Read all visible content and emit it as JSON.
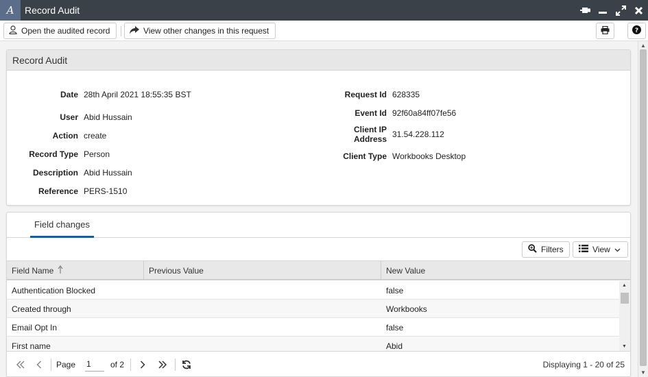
{
  "window": {
    "title": "Record Audit",
    "logo_letter": "A",
    "accent": "#1f5b94"
  },
  "toolbar": {
    "open_record_label": "Open the audited record",
    "view_changes_label": "View other changes in this request"
  },
  "audit": {
    "heading": "Record Audit",
    "left_fields": [
      {
        "label": "Date",
        "value": "28th April 2021 18:55:35 BST"
      },
      {
        "label": "User",
        "value": "Abid Hussain"
      },
      {
        "label": "Action",
        "value": "create"
      },
      {
        "label": "Record Type",
        "value": "Person"
      },
      {
        "label": "Description",
        "value": "Abid Hussain"
      },
      {
        "label": "Reference",
        "value": "PERS-1510"
      }
    ],
    "right_fields": [
      {
        "label": "Request Id",
        "value": "628335"
      },
      {
        "label": "Event Id",
        "value": "92f60a84ff07fe56"
      },
      {
        "label_line1": "Client IP",
        "label_line2": "Address",
        "value": "31.54.228.112"
      },
      {
        "label": "Client Type",
        "value": "Workbooks Desktop"
      }
    ]
  },
  "changes": {
    "tab_label": "Field changes",
    "filters_label": "Filters",
    "view_label": "View",
    "columns": [
      "Field Name",
      "Previous Value",
      "New Value"
    ],
    "rows": [
      {
        "field": "Authentication Blocked",
        "previous": "",
        "new": "false"
      },
      {
        "field": "Created through",
        "previous": "",
        "new": "Workbooks"
      },
      {
        "field": "Email Opt In",
        "previous": "",
        "new": "false"
      },
      {
        "field": "First name",
        "previous": "",
        "new": "Abid"
      }
    ]
  },
  "pager": {
    "page_label": "Page",
    "current_page": "1",
    "of_label": "of 2",
    "display_text": "Displaying 1 - 20 of 25"
  }
}
